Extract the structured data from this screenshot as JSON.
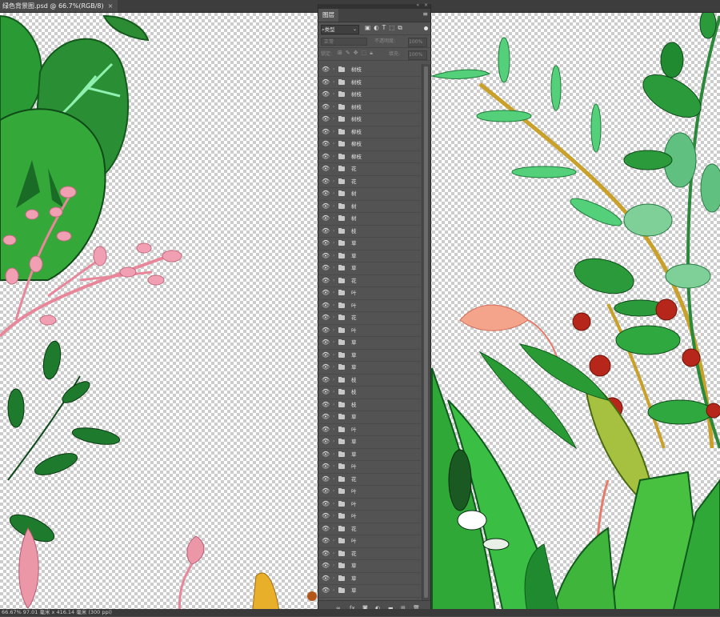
{
  "tab": {
    "title": "绿色背景图.psd @ 66.7%(RGB/8)",
    "close": "×"
  },
  "status": {
    "zoom": "66.67%",
    "info": "97.01 毫米 x 416.14 毫米 (300 ppi)"
  },
  "layers_panel": {
    "title": "图层",
    "menu_glyph": "≡",
    "collapse_glyph": "«",
    "close_glyph": "×",
    "filter": {
      "label": "类型",
      "icons": [
        "image-filter-icon",
        "adjustment-filter-icon",
        "text-filter-icon",
        "shape-filter-icon",
        "smart-object-filter-icon"
      ]
    },
    "blend_mode": "正常",
    "opacity_label": "不透明度:",
    "opacity_value": "100%",
    "lock_label": "锁定:",
    "fill_label": "填充:",
    "fill_value": "100%",
    "layers": [
      {
        "name": "树枝"
      },
      {
        "name": "树枝"
      },
      {
        "name": "树枝"
      },
      {
        "name": "树枝"
      },
      {
        "name": "树枝"
      },
      {
        "name": "柳枝"
      },
      {
        "name": "柳枝"
      },
      {
        "name": "柳枝"
      },
      {
        "name": "花"
      },
      {
        "name": "花"
      },
      {
        "name": "树"
      },
      {
        "name": "树"
      },
      {
        "name": "树"
      },
      {
        "name": "枝"
      },
      {
        "name": "草"
      },
      {
        "name": "草"
      },
      {
        "name": "草"
      },
      {
        "name": "花"
      },
      {
        "name": "叶"
      },
      {
        "name": "叶"
      },
      {
        "name": "花"
      },
      {
        "name": "叶"
      },
      {
        "name": "草"
      },
      {
        "name": "草"
      },
      {
        "name": "草"
      },
      {
        "name": "枝"
      },
      {
        "name": "枝"
      },
      {
        "name": "枝"
      },
      {
        "name": "草"
      },
      {
        "name": "叶"
      },
      {
        "name": "草"
      },
      {
        "name": "草"
      },
      {
        "name": "叶"
      },
      {
        "name": "花"
      },
      {
        "name": "叶"
      },
      {
        "name": "叶"
      },
      {
        "name": "叶"
      },
      {
        "name": "花"
      },
      {
        "name": "叶"
      },
      {
        "name": "花"
      },
      {
        "name": "草"
      },
      {
        "name": "草"
      },
      {
        "name": "草"
      },
      {
        "name": "草"
      },
      {
        "name": "草"
      }
    ],
    "footer_icons": [
      "link-icon",
      "fx-icon",
      "mask-icon",
      "adjustment-icon",
      "folder-icon",
      "new-layer-icon",
      "trash-icon"
    ]
  },
  "colors": {
    "panel_bg": "#535353",
    "canvas_leaf_dark": "#1f7a2a",
    "canvas_leaf_light": "#43b845",
    "flower_pink": "#e88fa3",
    "berry_red": "#b02a1a"
  }
}
